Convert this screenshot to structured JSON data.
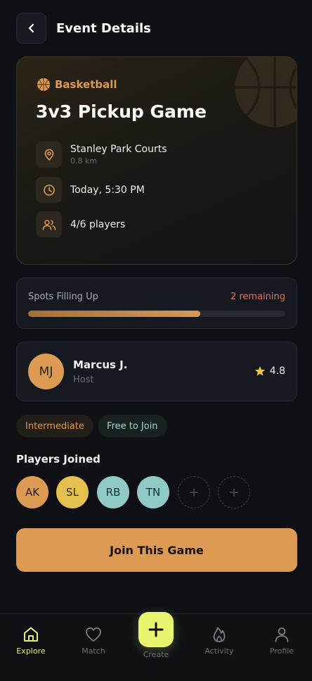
{
  "header": {
    "title": "Event Details"
  },
  "event": {
    "sport": "Basketball",
    "title": "3v3 Pickup Game",
    "location": "Stanley Park Courts",
    "distance": "0.8 km",
    "time": "Today, 5:30 PM",
    "players": "4/6 players"
  },
  "spots": {
    "label": "Spots Filling Up",
    "remaining": "2 remaining",
    "fill_fraction": 0.67
  },
  "host": {
    "initials": "MJ",
    "name": "Marcus J.",
    "role": "Host",
    "rating": "4.8"
  },
  "tags": {
    "level": "Intermediate",
    "price": "Free to Join"
  },
  "players_joined": {
    "heading": "Players Joined",
    "list": [
      {
        "initials": "AK",
        "color": "#dc9a53",
        "text_color": "#2b1f12"
      },
      {
        "initials": "SL",
        "color": "#e4c04e",
        "text_color": "#2b2410"
      },
      {
        "initials": "RB",
        "color": "#8fcac6",
        "text_color": "#13302d"
      },
      {
        "initials": "TN",
        "color": "#8fcac6",
        "text_color": "#13302d"
      }
    ],
    "empty_slot_symbol": "+"
  },
  "join_button": {
    "label": "Join This Game"
  },
  "nav": {
    "explore": "Explore",
    "match": "Match",
    "create": "Create",
    "activity": "Activity",
    "profile": "Profile"
  },
  "colors": {
    "accent": "#dc9a53",
    "nav_active": "#e6f06e",
    "remaining": "#e0755a",
    "background": "#0e1015"
  }
}
